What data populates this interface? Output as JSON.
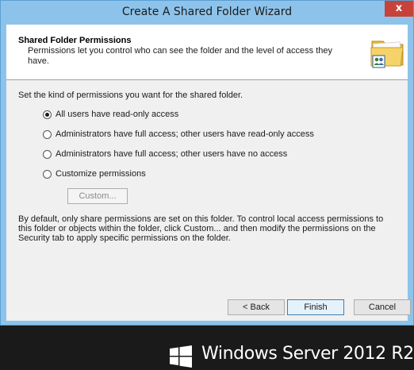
{
  "window": {
    "title": "Create A Shared Folder Wizard",
    "close_glyph": "x"
  },
  "header": {
    "title": "Shared Folder Permissions",
    "description": "Permissions let you control who can see the folder and the level of access they have.",
    "icon": "shared-folder-icon"
  },
  "prompt": "Set the kind of permissions you want for the shared folder.",
  "options": [
    {
      "label": "All users have read-only access",
      "checked": true
    },
    {
      "label": "Administrators have full access; other users have read-only access",
      "checked": false
    },
    {
      "label": "Administrators have full access; other users have no access",
      "checked": false
    },
    {
      "label": "Customize permissions",
      "checked": false
    }
  ],
  "custom_button": {
    "label": "Custom...",
    "enabled": false
  },
  "info_text": "By default, only share permissions are set on this folder. To control local access permissions to this folder or objects within the folder, click Custom... and then modify the permissions on the Security tab to apply specific permissions on the folder.",
  "buttons": {
    "back": "< Back",
    "finish": "Finish",
    "cancel": "Cancel"
  },
  "branding": {
    "text": "Windows Server 2012 R2"
  },
  "colors": {
    "title_bar": "#8dc3ea",
    "close_button": "#c7433a",
    "background": "#f0f0f0",
    "footer": "#1a1a1a"
  }
}
